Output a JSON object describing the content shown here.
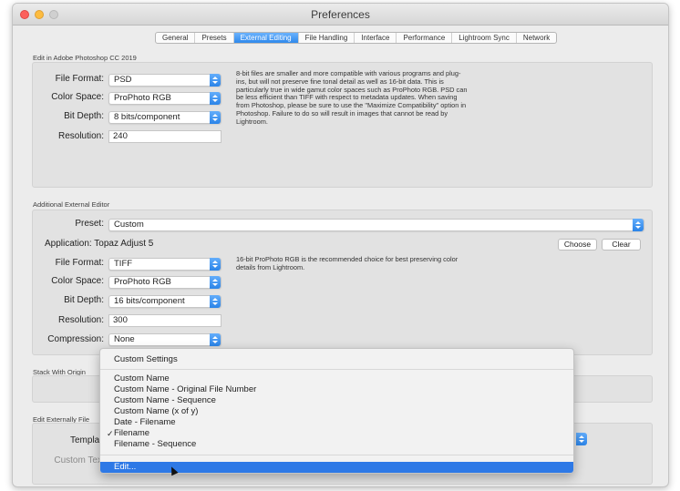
{
  "window": {
    "title": "Preferences"
  },
  "tabs": [
    "General",
    "Presets",
    "External Editing",
    "File Handling",
    "Interface",
    "Performance",
    "Lightroom Sync",
    "Network"
  ],
  "photoshop": {
    "section_label": "Edit in Adobe Photoshop CC 2019",
    "file_format_label": "File Format:",
    "file_format": "PSD",
    "color_space_label": "Color Space:",
    "color_space": "ProPhoto RGB",
    "bit_depth_label": "Bit Depth:",
    "bit_depth": "8 bits/component",
    "resolution_label": "Resolution:",
    "resolution": "240",
    "info": "8-bit files are smaller and more compatible with various programs and plug-ins, but will not preserve fine tonal detail as well as 16-bit data. This is particularly true in wide gamut color spaces such as ProPhoto RGB. PSD can be less efficient than TIFF with respect to metadata updates. When saving from Photoshop, please be sure to use the \"Maximize Compatibility\" option in Photoshop. Failure to do so will result in images that cannot be read by Lightroom."
  },
  "additional": {
    "section_label": "Additional External Editor",
    "preset_label": "Preset:",
    "preset": "Custom",
    "application": "Application: Topaz Adjust 5",
    "choose_label": "Choose",
    "clear_label": "Clear",
    "file_format_label": "File Format:",
    "file_format": "TIFF",
    "color_space_label": "Color Space:",
    "color_space": "ProPhoto RGB",
    "bit_depth_label": "Bit Depth:",
    "bit_depth": "16 bits/component",
    "resolution_label": "Resolution:",
    "resolution": "300",
    "compression_label": "Compression:",
    "compression": "None",
    "info": "16-bit ProPhoto RGB is the recommended choice for best preserving color details from Lightroom."
  },
  "stack": {
    "section_label": "Stack With Origin"
  },
  "naming": {
    "section_label": "Edit Externally File",
    "template_label": "Templat",
    "custom_text_label": "Custom Tex"
  },
  "menu": {
    "header": "Custom Settings",
    "items": [
      "Custom Name",
      "Custom Name - Original File Number",
      "Custom Name - Sequence",
      "Custom Name (x of y)",
      "Date - Filename",
      "Filename",
      "Filename - Sequence"
    ],
    "checked_mark": "✓",
    "edit": "Edit..."
  }
}
